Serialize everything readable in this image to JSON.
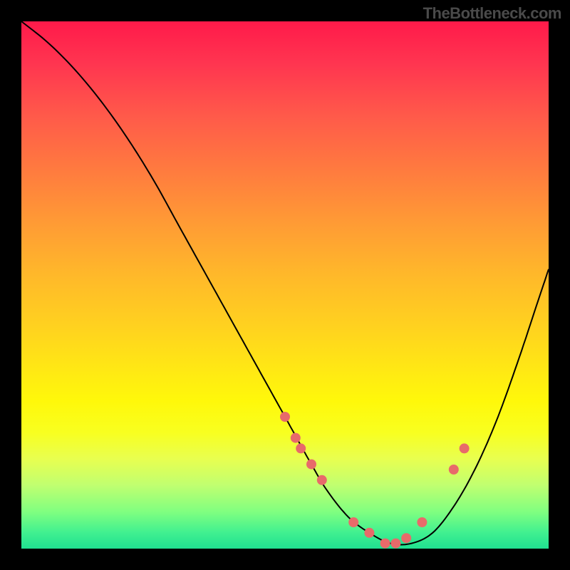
{
  "watermark": "TheBottleneck.com",
  "chart_data": {
    "type": "line",
    "title": "",
    "xlabel": "",
    "ylabel": "",
    "xlim": [
      0,
      100
    ],
    "ylim": [
      0,
      100
    ],
    "curve": {
      "x": [
        0,
        5,
        10,
        15,
        20,
        25,
        30,
        35,
        40,
        45,
        50,
        55,
        58,
        62,
        66,
        70,
        74,
        78,
        82,
        86,
        90,
        94,
        98,
        100
      ],
      "y": [
        100,
        96,
        91,
        85,
        78,
        70,
        61,
        52,
        43,
        34,
        25,
        16,
        11,
        6,
        3,
        1,
        1,
        3,
        8,
        15,
        24,
        35,
        47,
        53
      ]
    },
    "markers": {
      "x": [
        50,
        52,
        53,
        55,
        57,
        63,
        66,
        69,
        71,
        73,
        76,
        82,
        84
      ],
      "y": [
        25,
        21,
        19,
        16,
        13,
        5,
        3,
        1,
        1,
        2,
        5,
        15,
        19
      ]
    },
    "marker_color": "#e86a6a",
    "curve_color": "#000000"
  }
}
